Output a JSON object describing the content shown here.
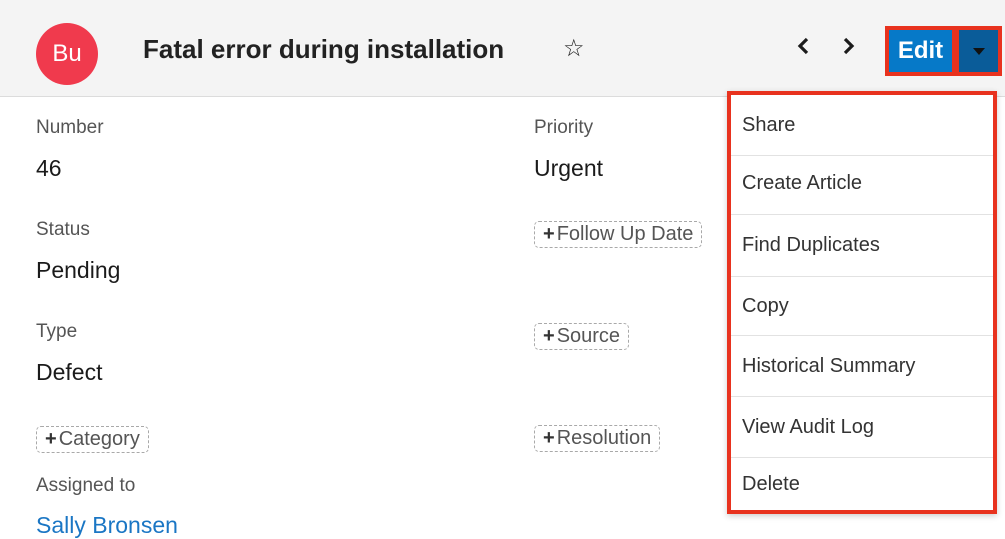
{
  "header": {
    "avatar_initials": "Bu",
    "title": "Fatal error during installation",
    "prev_icon": "‹",
    "next_icon": "›",
    "edit_label": "Edit"
  },
  "fields": {
    "number": {
      "label": "Number",
      "value": "46"
    },
    "priority": {
      "label": "Priority",
      "value": "Urgent"
    },
    "status": {
      "label": "Status",
      "value": "Pending"
    },
    "type": {
      "label": "Type",
      "value": "Defect"
    },
    "assigned_to": {
      "label": "Assigned to",
      "value": "Sally Bronsen"
    },
    "follow_up_date": "Follow Up Date",
    "source": "Source",
    "category": "Category",
    "resolution": "Resolution"
  },
  "menu": {
    "items": [
      "Share",
      "Create Article",
      "Find Duplicates",
      "Copy",
      "Historical Summary",
      "View Audit Log",
      "Delete"
    ]
  },
  "colors": {
    "avatar_bg": "#f03a4d",
    "primary_button": "#0679c8",
    "link": "#1a76c4",
    "highlight": "#e8321e"
  }
}
